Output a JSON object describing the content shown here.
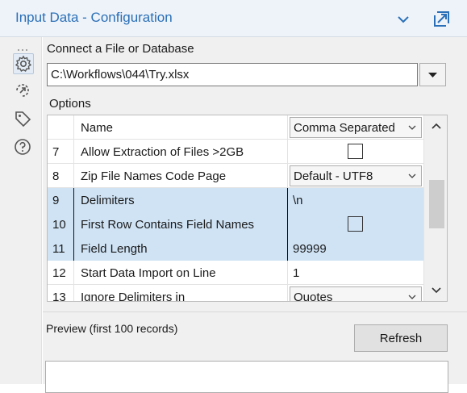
{
  "window": {
    "title": "Input Data - Configuration",
    "collapse_icon": "chevron-down-icon",
    "undock_icon": "undock-icon"
  },
  "sidebar": {
    "items": [
      {
        "name": "configuration",
        "icon": "gear-icon",
        "active": true
      },
      {
        "name": "connection",
        "icon": "connection-icon",
        "active": false
      },
      {
        "name": "annotation",
        "icon": "tag-icon",
        "active": false
      },
      {
        "name": "help",
        "icon": "help-icon",
        "active": false
      }
    ]
  },
  "connect": {
    "label": "Connect a File or Database",
    "value": "C:\\Workflows\\044\\Try.xlsx"
  },
  "options": {
    "label": "Options",
    "header": {
      "num": "",
      "name": "Name",
      "value": "Comma Separated"
    },
    "rows": [
      {
        "num": "7",
        "name": "Allow Extraction of Files >2GB",
        "value": "",
        "type": "checkbox",
        "checked": false,
        "selected": false
      },
      {
        "num": "8",
        "name": "Zip File Names Code Page",
        "value": "Default - UTF8",
        "type": "dropdown",
        "selected": false
      },
      {
        "num": "9",
        "name": "Delimiters",
        "value": "\\n",
        "type": "text",
        "selected": true
      },
      {
        "num": "10",
        "name": "First Row Contains Field Names",
        "value": "",
        "type": "checkbox",
        "checked": false,
        "selected": true
      },
      {
        "num": "11",
        "name": "Field Length",
        "value": "99999",
        "type": "text",
        "selected": true
      },
      {
        "num": "12",
        "name": "Start Data Import on Line",
        "value": "1",
        "type": "text",
        "selected": false
      },
      {
        "num": "13",
        "name": "Ignore Delimiters in",
        "value": "Quotes",
        "type": "dropdown",
        "selected": false
      }
    ]
  },
  "preview": {
    "label": "Preview (first 100 records)",
    "refresh_label": "Refresh"
  },
  "colors": {
    "title": "#2a6fb7",
    "selection": "#cfe3f5",
    "panel": "#f0f0f0"
  }
}
